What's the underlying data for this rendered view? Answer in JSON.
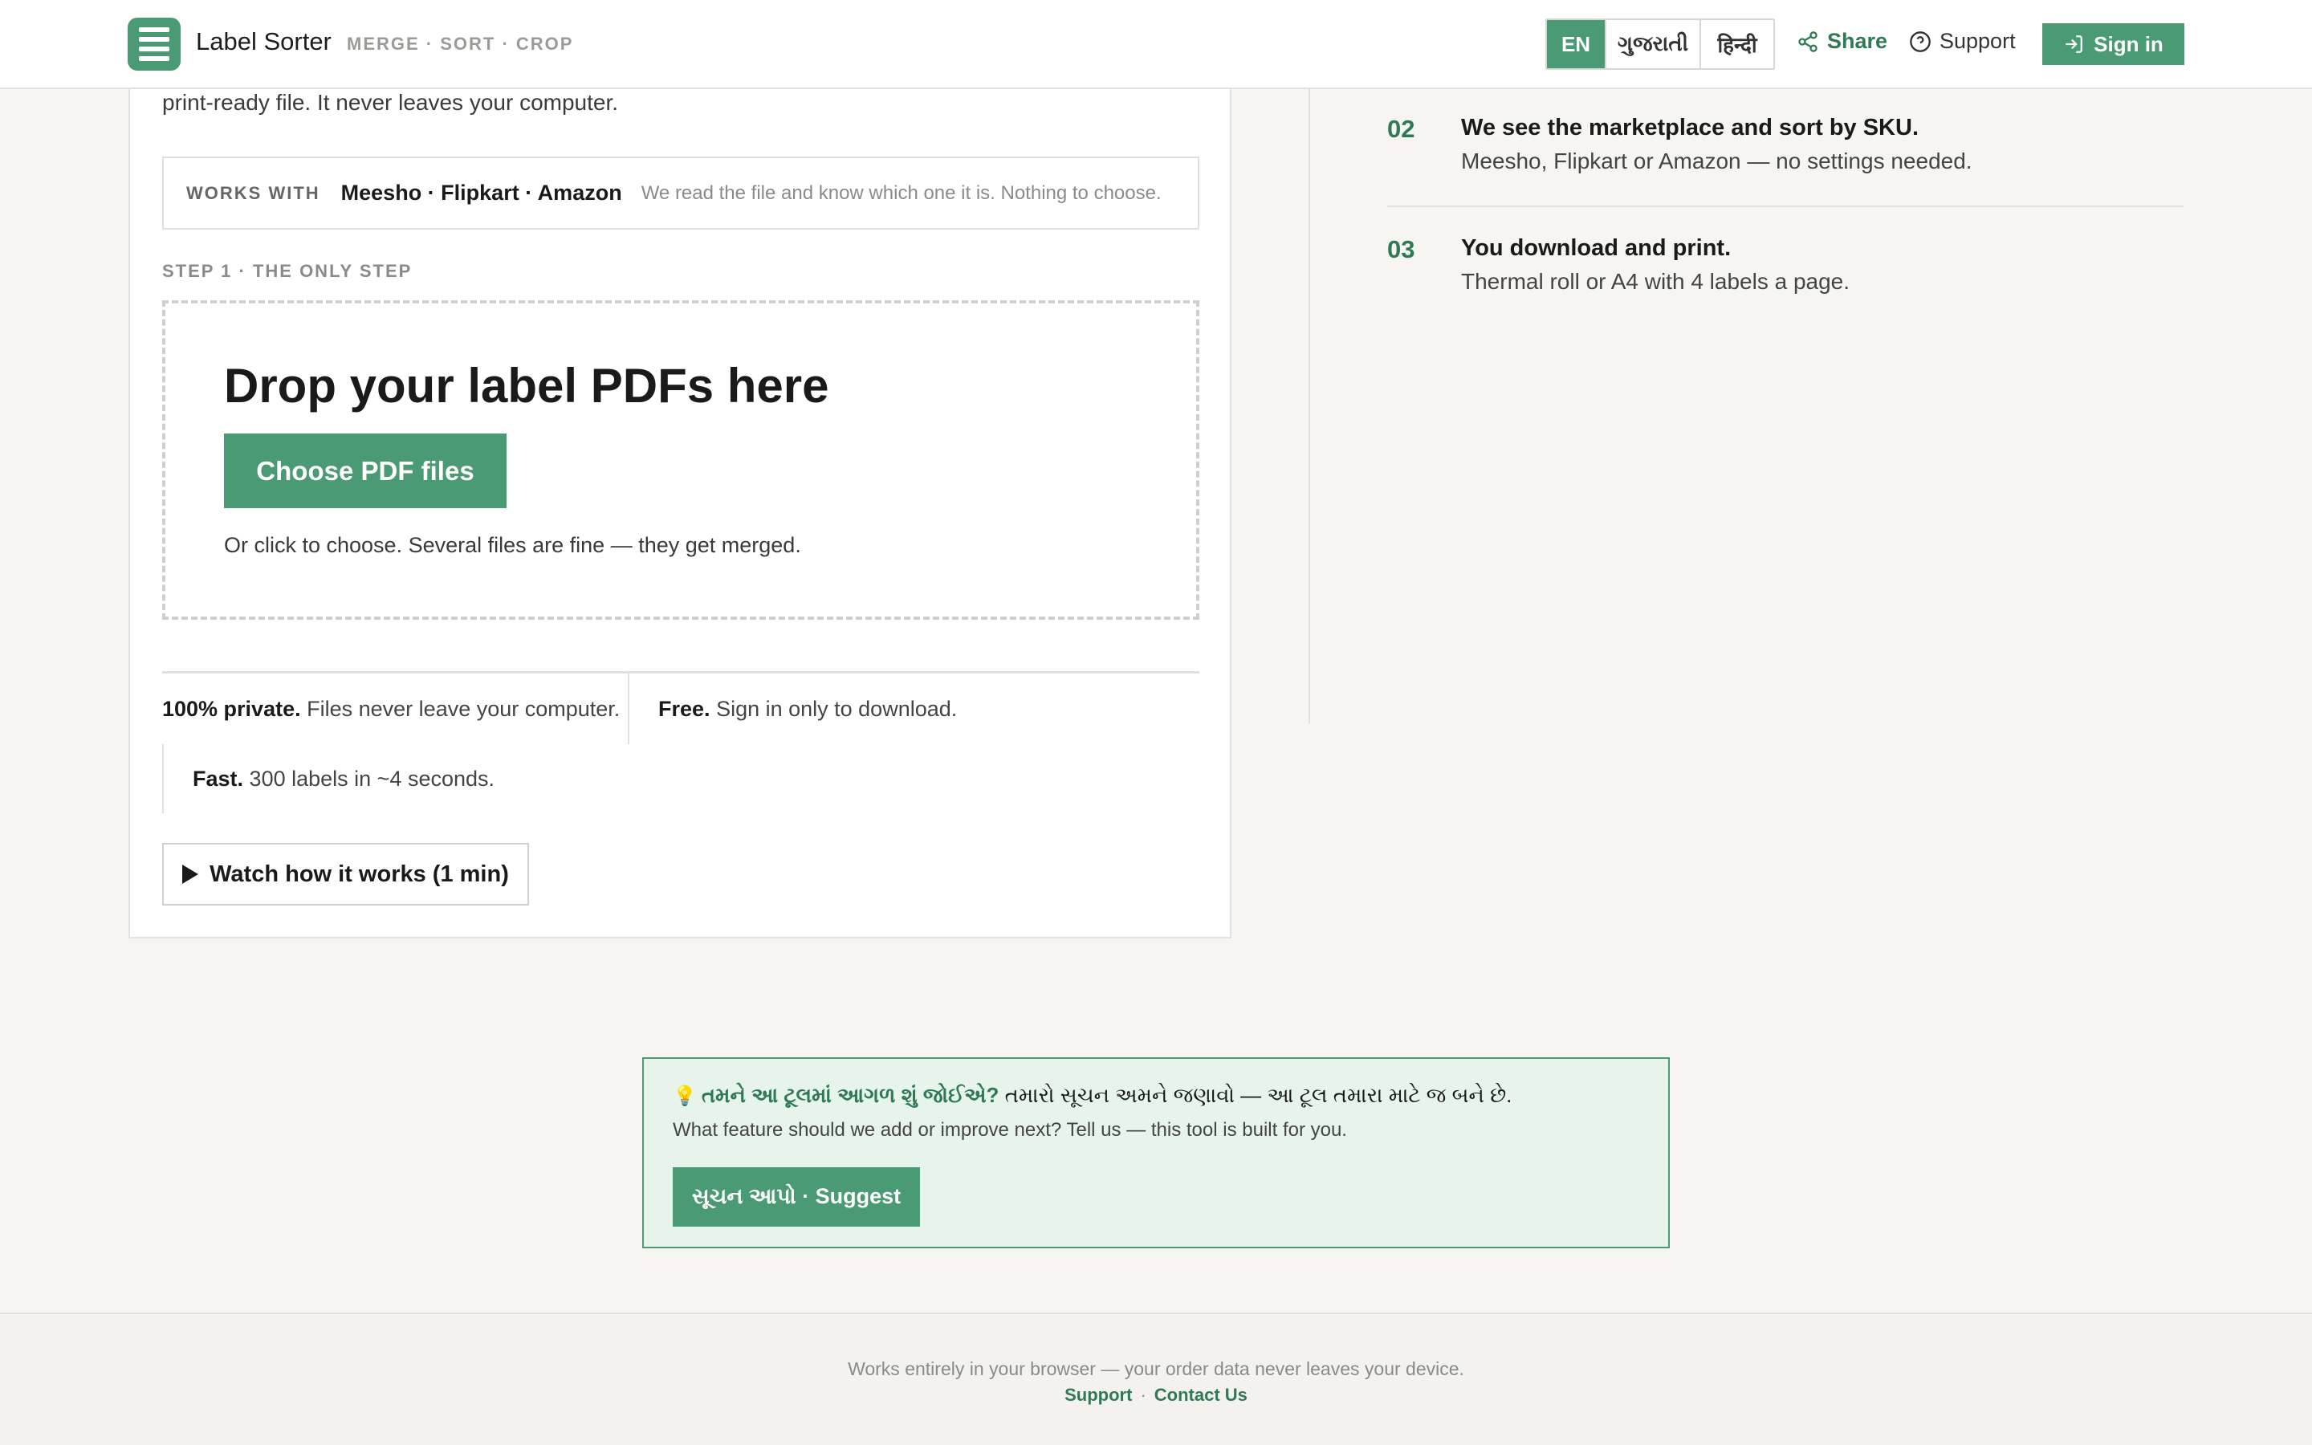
{
  "app": {
    "title": "Label Sorter",
    "tagline": "MERGE · SORT · CROP",
    "brand_color": "#4a9b73"
  },
  "header": {
    "languages": [
      {
        "label": "EN",
        "active": true
      },
      {
        "label": "ગુજરાતી",
        "active": false
      },
      {
        "label": "हिन्दी",
        "active": false
      }
    ],
    "share_label": "Share",
    "support_label": "Support",
    "signin_label": "Sign in",
    "icons": {
      "share": "share-icon",
      "support": "help-circle-icon",
      "signin": "sign-in-icon"
    }
  },
  "main": {
    "intro_tail": "print-ready file. It never leaves your computer.",
    "works_with": {
      "label": "WORKS WITH",
      "marketplaces": "Meesho · Flipkart · Amazon",
      "note": "We read the file and know which one it is. Nothing to choose."
    },
    "step_label": "STEP 1 · THE ONLY STEP",
    "dropzone": {
      "title": "Drop your label PDFs here",
      "button": "Choose PDF files",
      "note": "Or click to choose. Several files are fine — they get merged."
    },
    "features": [
      {
        "bold": "100% private.",
        "text": "Files never leave your computer."
      },
      {
        "bold": "Free.",
        "text": "Sign in only to download."
      },
      {
        "bold": "Fast.",
        "text": "300 labels in ~4 seconds."
      }
    ],
    "watch_label": "Watch how it works (1 min)"
  },
  "steps": [
    {
      "num": "02",
      "title": "We see the marketplace and sort by SKU.",
      "desc": "Meesho, Flipkart or Amazon — no settings needed."
    },
    {
      "num": "03",
      "title": "You download and print.",
      "desc": "Thermal roll or A4 with 4 labels a page."
    }
  ],
  "feedback": {
    "question": "તમને આ ટૂલમાં આગળ શું જોઈએ?",
    "question_tail": "તમારો સૂચન અમને જણાવો — આ ટૂલ તમારા માટે જ બને છે.",
    "english": "What feature should we add or improve next? Tell us — this tool is built for you.",
    "button": "સૂચન આપો · Suggest",
    "icon": "lightbulb-icon"
  },
  "footer": {
    "note": "Works entirely in your browser — your order data never leaves your device.",
    "links": [
      "Support",
      "Contact Us"
    ]
  }
}
